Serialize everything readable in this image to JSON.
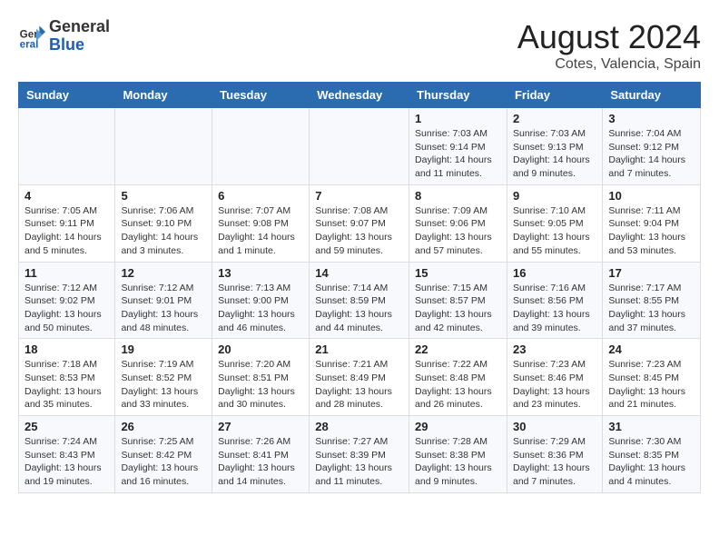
{
  "logo": {
    "general": "General",
    "blue": "Blue"
  },
  "title": "August 2024",
  "subtitle": "Cotes, Valencia, Spain",
  "days_header": [
    "Sunday",
    "Monday",
    "Tuesday",
    "Wednesday",
    "Thursday",
    "Friday",
    "Saturday"
  ],
  "weeks": [
    [
      {
        "day": "",
        "info": ""
      },
      {
        "day": "",
        "info": ""
      },
      {
        "day": "",
        "info": ""
      },
      {
        "day": "",
        "info": ""
      },
      {
        "day": "1",
        "info": "Sunrise: 7:03 AM\nSunset: 9:14 PM\nDaylight: 14 hours and 11 minutes."
      },
      {
        "day": "2",
        "info": "Sunrise: 7:03 AM\nSunset: 9:13 PM\nDaylight: 14 hours and 9 minutes."
      },
      {
        "day": "3",
        "info": "Sunrise: 7:04 AM\nSunset: 9:12 PM\nDaylight: 14 hours and 7 minutes."
      }
    ],
    [
      {
        "day": "4",
        "info": "Sunrise: 7:05 AM\nSunset: 9:11 PM\nDaylight: 14 hours and 5 minutes."
      },
      {
        "day": "5",
        "info": "Sunrise: 7:06 AM\nSunset: 9:10 PM\nDaylight: 14 hours and 3 minutes."
      },
      {
        "day": "6",
        "info": "Sunrise: 7:07 AM\nSunset: 9:08 PM\nDaylight: 14 hours and 1 minute."
      },
      {
        "day": "7",
        "info": "Sunrise: 7:08 AM\nSunset: 9:07 PM\nDaylight: 13 hours and 59 minutes."
      },
      {
        "day": "8",
        "info": "Sunrise: 7:09 AM\nSunset: 9:06 PM\nDaylight: 13 hours and 57 minutes."
      },
      {
        "day": "9",
        "info": "Sunrise: 7:10 AM\nSunset: 9:05 PM\nDaylight: 13 hours and 55 minutes."
      },
      {
        "day": "10",
        "info": "Sunrise: 7:11 AM\nSunset: 9:04 PM\nDaylight: 13 hours and 53 minutes."
      }
    ],
    [
      {
        "day": "11",
        "info": "Sunrise: 7:12 AM\nSunset: 9:02 PM\nDaylight: 13 hours and 50 minutes."
      },
      {
        "day": "12",
        "info": "Sunrise: 7:12 AM\nSunset: 9:01 PM\nDaylight: 13 hours and 48 minutes."
      },
      {
        "day": "13",
        "info": "Sunrise: 7:13 AM\nSunset: 9:00 PM\nDaylight: 13 hours and 46 minutes."
      },
      {
        "day": "14",
        "info": "Sunrise: 7:14 AM\nSunset: 8:59 PM\nDaylight: 13 hours and 44 minutes."
      },
      {
        "day": "15",
        "info": "Sunrise: 7:15 AM\nSunset: 8:57 PM\nDaylight: 13 hours and 42 minutes."
      },
      {
        "day": "16",
        "info": "Sunrise: 7:16 AM\nSunset: 8:56 PM\nDaylight: 13 hours and 39 minutes."
      },
      {
        "day": "17",
        "info": "Sunrise: 7:17 AM\nSunset: 8:55 PM\nDaylight: 13 hours and 37 minutes."
      }
    ],
    [
      {
        "day": "18",
        "info": "Sunrise: 7:18 AM\nSunset: 8:53 PM\nDaylight: 13 hours and 35 minutes."
      },
      {
        "day": "19",
        "info": "Sunrise: 7:19 AM\nSunset: 8:52 PM\nDaylight: 13 hours and 33 minutes."
      },
      {
        "day": "20",
        "info": "Sunrise: 7:20 AM\nSunset: 8:51 PM\nDaylight: 13 hours and 30 minutes."
      },
      {
        "day": "21",
        "info": "Sunrise: 7:21 AM\nSunset: 8:49 PM\nDaylight: 13 hours and 28 minutes."
      },
      {
        "day": "22",
        "info": "Sunrise: 7:22 AM\nSunset: 8:48 PM\nDaylight: 13 hours and 26 minutes."
      },
      {
        "day": "23",
        "info": "Sunrise: 7:23 AM\nSunset: 8:46 PM\nDaylight: 13 hours and 23 minutes."
      },
      {
        "day": "24",
        "info": "Sunrise: 7:23 AM\nSunset: 8:45 PM\nDaylight: 13 hours and 21 minutes."
      }
    ],
    [
      {
        "day": "25",
        "info": "Sunrise: 7:24 AM\nSunset: 8:43 PM\nDaylight: 13 hours and 19 minutes."
      },
      {
        "day": "26",
        "info": "Sunrise: 7:25 AM\nSunset: 8:42 PM\nDaylight: 13 hours and 16 minutes."
      },
      {
        "day": "27",
        "info": "Sunrise: 7:26 AM\nSunset: 8:41 PM\nDaylight: 13 hours and 14 minutes."
      },
      {
        "day": "28",
        "info": "Sunrise: 7:27 AM\nSunset: 8:39 PM\nDaylight: 13 hours and 11 minutes."
      },
      {
        "day": "29",
        "info": "Sunrise: 7:28 AM\nSunset: 8:38 PM\nDaylight: 13 hours and 9 minutes."
      },
      {
        "day": "30",
        "info": "Sunrise: 7:29 AM\nSunset: 8:36 PM\nDaylight: 13 hours and 7 minutes."
      },
      {
        "day": "31",
        "info": "Sunrise: 7:30 AM\nSunset: 8:35 PM\nDaylight: 13 hours and 4 minutes."
      }
    ]
  ]
}
